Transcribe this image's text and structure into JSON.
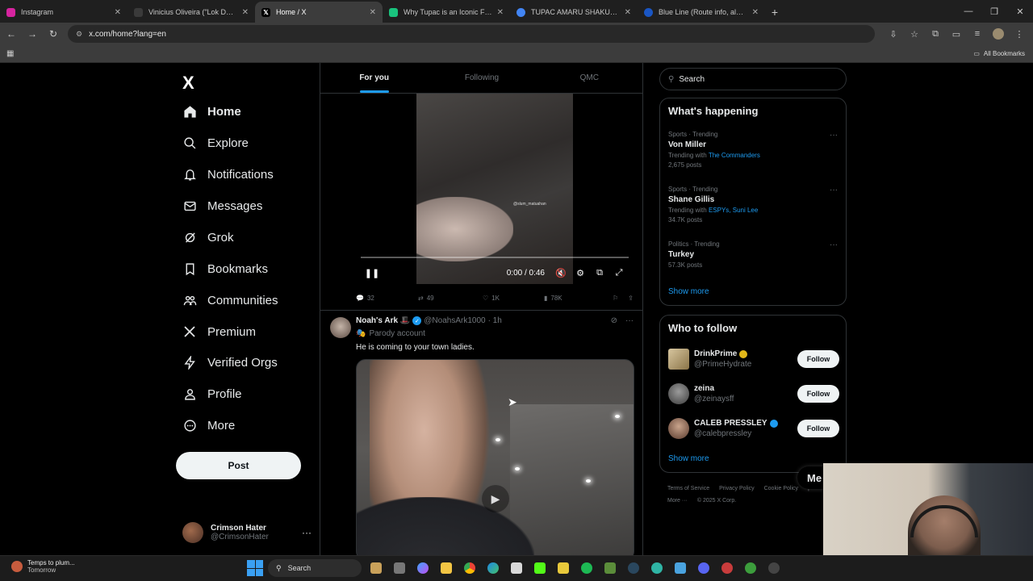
{
  "browser": {
    "tabs": [
      {
        "label": "Instagram",
        "fav_color": "#d6249f",
        "active": false
      },
      {
        "label": "Vinicius Oliveira (\"Lok Dog\") | M",
        "fav_color": "#3a3a3a",
        "active": false
      },
      {
        "label": "Home / X",
        "fav_color": "#000000",
        "active": true
      },
      {
        "label": "Why Tupac is an Iconic Figure",
        "fav_color": "#19c37d",
        "active": false
      },
      {
        "label": "TUPAC AMARU SHAKUR FOUN",
        "fav_color": "#4285f4",
        "active": false
      },
      {
        "label": "Blue Line (Route info, alerts & s",
        "fav_color": "#1a56c4",
        "active": false
      }
    ],
    "url": "x.com/home?lang=en",
    "all_bookmarks": "All Bookmarks"
  },
  "nav": {
    "logo": "X",
    "items": [
      {
        "label": "Home",
        "icon": "home-icon"
      },
      {
        "label": "Explore",
        "icon": "search-icon"
      },
      {
        "label": "Notifications",
        "icon": "bell-icon"
      },
      {
        "label": "Messages",
        "icon": "envelope-icon"
      },
      {
        "label": "Grok",
        "icon": "grok-icon"
      },
      {
        "label": "Bookmarks",
        "icon": "bookmark-icon"
      },
      {
        "label": "Communities",
        "icon": "people-icon"
      },
      {
        "label": "Premium",
        "icon": "x-icon"
      },
      {
        "label": "Verified Orgs",
        "icon": "lightning-icon"
      },
      {
        "label": "Profile",
        "icon": "person-icon"
      },
      {
        "label": "More",
        "icon": "more-circle-icon"
      }
    ],
    "post_label": "Post",
    "me": {
      "name": "Crimson Hater",
      "handle": "@CrimsonHater"
    }
  },
  "feed": {
    "tabs": [
      "For you",
      "Following",
      "QMC"
    ],
    "video1": {
      "time": "0:00 / 0:46",
      "watermark": "@slum_matuahan"
    },
    "post1_actions": {
      "replies": "32",
      "reposts": "49",
      "likes": "1K",
      "views": "78K"
    },
    "post2": {
      "name": "Noah's Ark 🎩",
      "handle": "@NoahsArk1000",
      "time": "· 1h",
      "parody": "Parody account",
      "text": "He is coming to your town ladies."
    }
  },
  "sidebar": {
    "search_placeholder": "Search",
    "happening": {
      "title": "What's happening",
      "trends": [
        {
          "meta": "Sports · Trending",
          "title": "Von Miller",
          "with_prefix": "Trending with ",
          "with_link": "The Commanders",
          "count": "2,675 posts"
        },
        {
          "meta": "Sports · Trending",
          "title": "Shane Gillis",
          "with_prefix": "Trending with ",
          "with_link": "ESPYs, Suni Lee",
          "count": "34.7K posts"
        },
        {
          "meta": "Politics · Trending",
          "title": "Turkey",
          "with_prefix": "",
          "with_link": "",
          "count": "57.3K posts"
        }
      ],
      "show_more": "Show more"
    },
    "who_to_follow": {
      "title": "Who to follow",
      "accounts": [
        {
          "name": "DrinkPrime",
          "handle": "@PrimeHydrate",
          "badge": "gold"
        },
        {
          "name": "zeina",
          "handle": "@zeinaysff",
          "badge": "none"
        },
        {
          "name": "CALEB PRESSLEY",
          "handle": "@calebpressley",
          "badge": "blue"
        }
      ],
      "follow_label": "Follow",
      "show_more": "Show more"
    },
    "footer": {
      "links": [
        "Terms of Service",
        "Privacy Policy",
        "Cookie Policy",
        "|"
      ],
      "more": "More ···",
      "copyright": "© 2025 X Corp."
    }
  },
  "messages_pill": "Me",
  "taskbar": {
    "weather_line1": "Temps to plum...",
    "weather_line2": "Tomorrow",
    "search_label": "Search"
  }
}
